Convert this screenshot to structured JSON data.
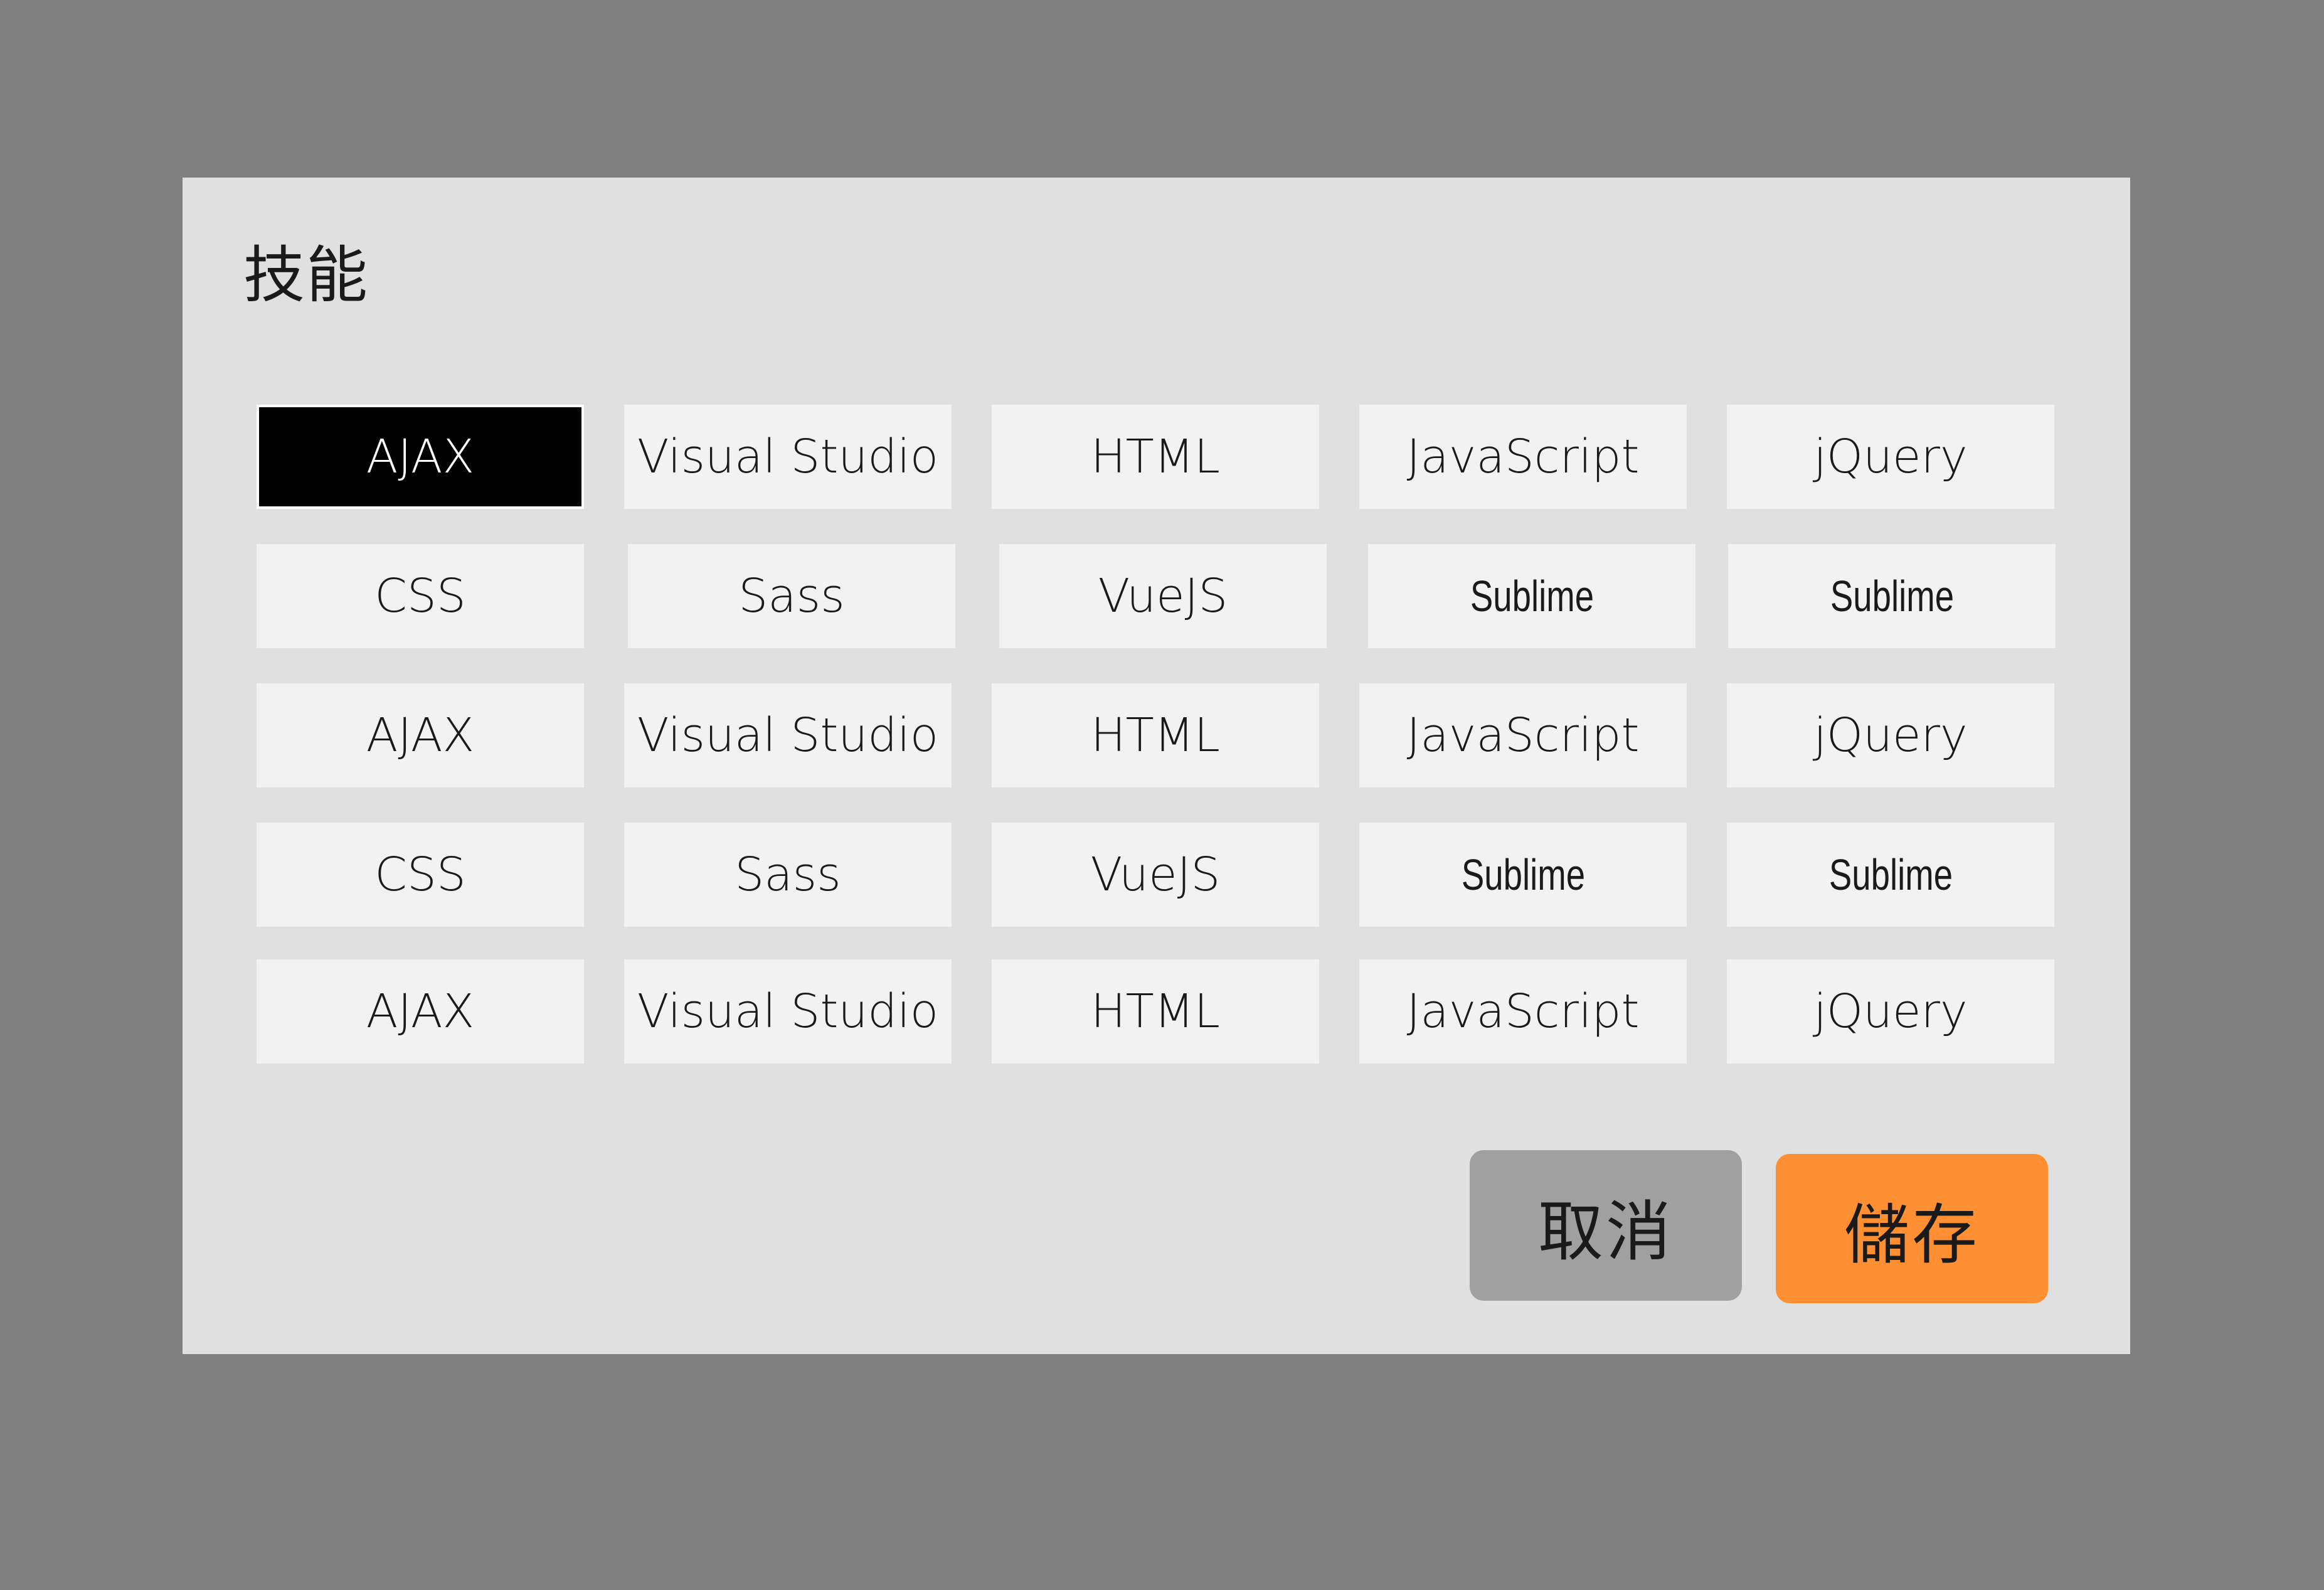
{
  "dialog": {
    "title": "技能",
    "cancel_label": "取消",
    "save_label": "儲存"
  },
  "colors": {
    "overlay": "#808080",
    "dialog_bg": "#e0e0e0",
    "tag_bg": "#f2f2f2",
    "tag_selected_bg": "#000000",
    "cancel_bg": "#a0a0a0",
    "save_bg": "#ff8f33"
  },
  "skills": {
    "rows": [
      [
        "AJAX",
        "Visual Studio",
        "HTML",
        "JavaScript",
        "jQuery"
      ],
      [
        "CSS",
        "Sass",
        "VueJS",
        "Sublime",
        "Sublime"
      ],
      [
        "AJAX",
        "Visual Studio",
        "HTML",
        "JavaScript",
        "jQuery"
      ],
      [
        "CSS",
        "Sass",
        "VueJS",
        "Sublime",
        "Sublime"
      ],
      [
        "AJAX",
        "Visual Studio",
        "HTML",
        "JavaScript",
        "jQuery"
      ]
    ],
    "selected": "AJAX"
  }
}
